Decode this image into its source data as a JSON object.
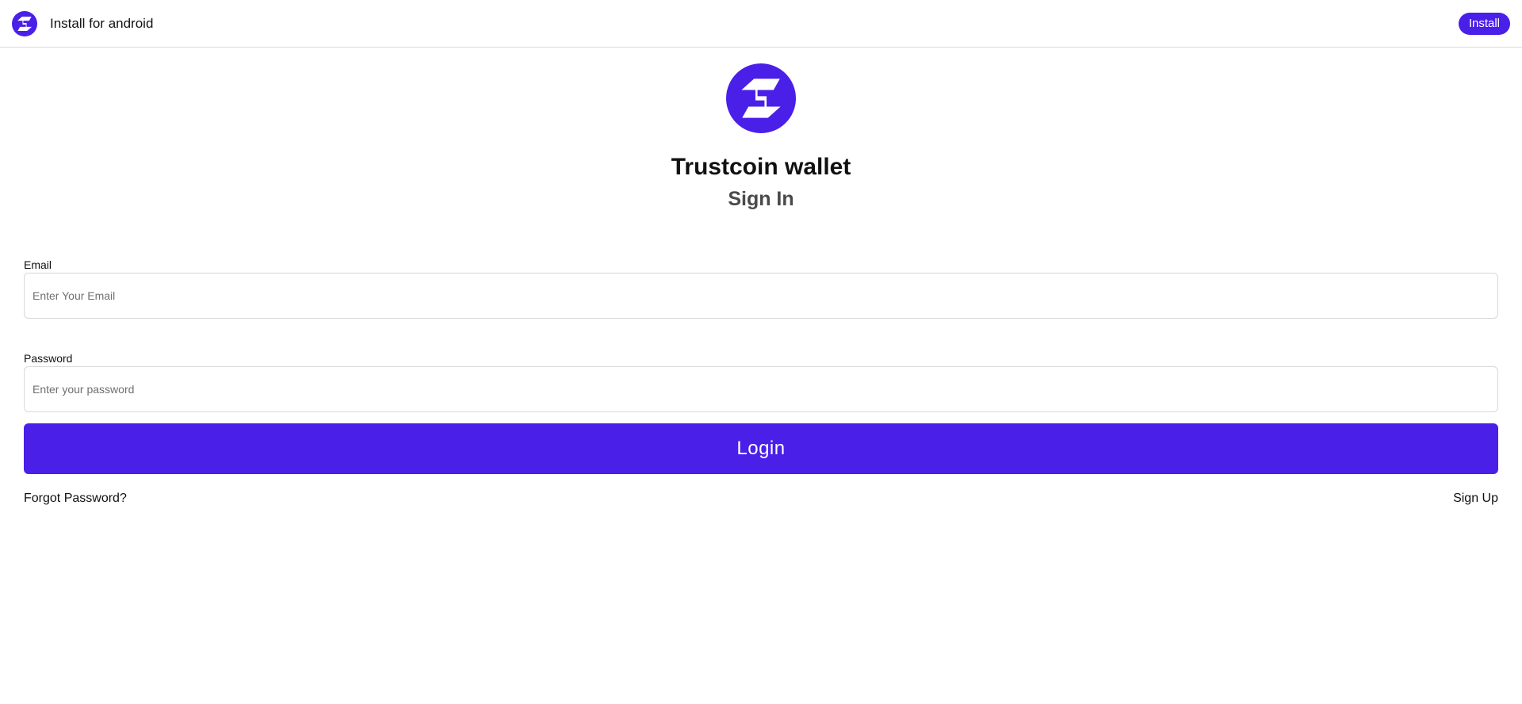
{
  "banner": {
    "text": "Install for android",
    "install_label": "Install"
  },
  "header": {
    "title": "Trustcoin wallet",
    "subtitle": "Sign In"
  },
  "form": {
    "email_label": "Email",
    "email_value": "",
    "email_placeholder": "Enter Your Email",
    "password_label": "Password",
    "password_value": "",
    "password_placeholder": "Enter your password",
    "login_label": "Login"
  },
  "links": {
    "forgot_password": "Forgot Password?",
    "sign_up": "Sign Up"
  },
  "icons": {
    "brand_logo": "trustcoin-logo-icon"
  },
  "colors": {
    "brand": "#4a1fe8",
    "background": "#ffffff",
    "text": "#111111",
    "muted_text": "#4a4a4a",
    "border": "#d8d8d8"
  }
}
